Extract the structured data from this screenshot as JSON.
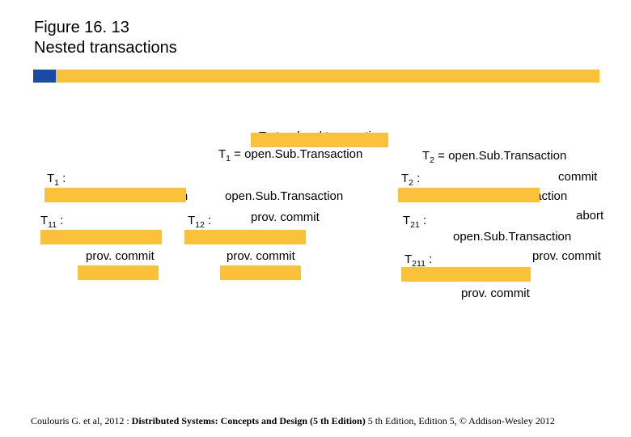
{
  "figure": {
    "number": "Figure 16. 13",
    "title": "Nested transactions"
  },
  "labels": {
    "top": "T  : top-level transaction",
    "t1eq": " = open.Sub.Transaction",
    "t2eq": " = open.Sub.Transaction",
    "commit": "commit",
    "open": "open.Sub.Transaction",
    "provcommit": "prov. commit",
    "abort": "abort",
    "t1": "T",
    "t2": "T",
    "t11": "T",
    "t12": "T",
    "t21": "T",
    "t211": "T",
    "s1": "1",
    "s2": "2",
    "s11": "11",
    "s12": "12",
    "s21": "21",
    "s211": "211",
    "colon": " :"
  },
  "citation": {
    "pre": "Coulouris G. et al, 2012 : ",
    "bold": "Distributed Systems: Concepts and Design (5 th Edition)",
    "post": " 5 th Edition, Edition 5, © Addison-Wesley 2012"
  }
}
